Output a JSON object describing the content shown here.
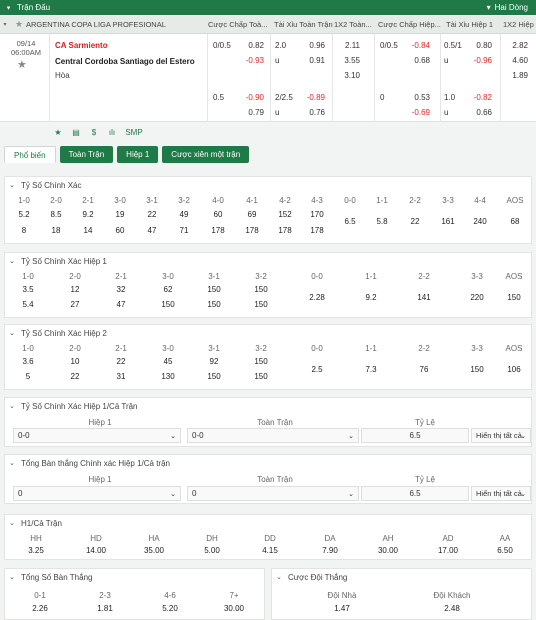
{
  "topbar": {
    "title": "Trận Đấu",
    "dropdown": "Hai Dòng"
  },
  "league": {
    "name": "ARGENTINA COPA LIGA PROFESIONAL",
    "headers": [
      "Cược Chấp Toà...",
      "Tài Xỉu Toàn Trận",
      "1X2 Toàn...",
      "Cược Chấp Hiệp...",
      "Tài Xỉu Hiệp 1",
      "1X2 Hiệp"
    ]
  },
  "match": {
    "date": "09/14",
    "time": "06:00AM",
    "home": "CA Sarmiento",
    "away": "Central Cordoba Santiago del Estero",
    "draw": "Hòa",
    "row1": {
      "ft_hdp_line": "0/0.5",
      "ft_hdp_home": "0.82",
      "ft_hdp_away": "-0.93",
      "ft_ou_line": "2.0",
      "ft_ou_over": "0.96",
      "ft_ou_u": "u",
      "ft_ou_under": "0.91",
      "ft_1x2_1": "2.11",
      "ft_1x2_2": "3.55",
      "ft_1x2_x": "3.10",
      "h1_hdp_line": "0/0.5",
      "h1_hdp_home": "-0.84",
      "h1_hdp_away": "0.68",
      "h1_ou_line": "0.5/1",
      "h1_ou_over": "0.80",
      "h1_ou_u": "u",
      "h1_ou_under": "-0.96",
      "h1_1x2_1": "2.82",
      "h1_1x2_2": "4.60",
      "h1_1x2_x": "1.89"
    },
    "row2": {
      "ft_hdp_line": "0.5",
      "ft_hdp_home": "-0.90",
      "ft_hdp_away": "0.79",
      "ft_ou_line": "2/2.5",
      "ft_ou_over": "-0.89",
      "ft_ou_u": "u",
      "ft_ou_under": "0.76",
      "h1_hdp_line": "0",
      "h1_hdp_home": "0.53",
      "h1_hdp_away": "-0.69",
      "h1_ou_line": "1.0",
      "h1_ou_over": "-0.82",
      "h1_ou_u": "u",
      "h1_ou_under": "0.66"
    },
    "tools": [
      "★",
      "▤",
      "$",
      "ılı",
      "SMP"
    ]
  },
  "tabs": [
    "Phổ biến",
    "Toàn Trận",
    "Hiệp 1",
    "Cược xiên một trận"
  ],
  "cs": {
    "title": "Tỷ Số Chính Xác",
    "h1": [
      "1-0",
      "2-0",
      "2-1",
      "3-0",
      "3-1",
      "3-2",
      "4-0",
      "4-1",
      "4-2",
      "4-3",
      "0-0",
      "1-1",
      "2-2",
      "3-3",
      "4-4",
      "AOS"
    ],
    "v1": [
      "5.2",
      "8.5",
      "9.2",
      "19",
      "22",
      "49",
      "60",
      "69",
      "152",
      "170",
      "6.5",
      "5.8",
      "22",
      "161",
      "240",
      "68"
    ],
    "v2": [
      "8",
      "18",
      "14",
      "60",
      "47",
      "71",
      "178",
      "178",
      "178",
      "178"
    ]
  },
  "cs1": {
    "title": "Tỷ Số Chính Xác Hiệp 1",
    "h": [
      "1-0",
      "2-0",
      "2-1",
      "3-0",
      "3-1",
      "3-2",
      "0-0",
      "1-1",
      "2-2",
      "3-3",
      "AOS"
    ],
    "v1": [
      "3.5",
      "12",
      "32",
      "62",
      "150",
      "150",
      "2.28",
      "9.2",
      "141",
      "220",
      "150"
    ],
    "v2": [
      "5.4",
      "27",
      "47",
      "150",
      "150",
      "150"
    ]
  },
  "cs2": {
    "title": "Tỷ Số Chính Xác Hiệp 2",
    "h": [
      "1-0",
      "2-0",
      "2-1",
      "3-0",
      "3-1",
      "3-2",
      "0-0",
      "1-1",
      "2-2",
      "3-3",
      "AOS"
    ],
    "v1": [
      "3.6",
      "10",
      "22",
      "45",
      "92",
      "150",
      "2.5",
      "7.3",
      "76",
      "150",
      "106"
    ],
    "v2": [
      "5",
      "22",
      "31",
      "130",
      "150",
      "150"
    ]
  },
  "htft_cs": {
    "title": "Tỷ Số Chính Xác Hiệp 1/Cả Trận",
    "col1": "Hiệp 1",
    "col2": "Toàn Trận",
    "col3": "Tỷ Lệ",
    "sel1": "0-0",
    "sel2": "0-0",
    "odds": "6.5",
    "show": "Hiển thị tất cả"
  },
  "tg_htft": {
    "title": "Tổng Bàn thắng Chính xác Hiệp 1/Cả trận",
    "col1": "Hiệp 1",
    "col2": "Toàn Trận",
    "col3": "Tỷ Lệ",
    "sel1": "0",
    "sel2": "0",
    "odds": "6.5",
    "show": "Hiển thị tất cả"
  },
  "htft": {
    "title": "H1/Cả Trận",
    "h": [
      "HH",
      "HD",
      "HA",
      "DH",
      "DD",
      "DA",
      "AH",
      "AD",
      "AA"
    ],
    "v": [
      "3.25",
      "14.00",
      "35.00",
      "5.00",
      "4.15",
      "7.90",
      "30.00",
      "17.00",
      "6.50"
    ]
  },
  "tg": {
    "title": "Tổng Số Bàn Thắng",
    "h": [
      "0-1",
      "2-3",
      "4-6",
      "7+"
    ],
    "v": [
      "2.26",
      "1.81",
      "5.20",
      "30.00"
    ]
  },
  "dc": {
    "title": "Cược Đội Thắng",
    "h": [
      "Đội Nhà",
      "Đội Khách"
    ],
    "v": [
      "1.47",
      "2.48"
    ]
  },
  "colors": {
    "green": "#1f7a47",
    "red": "#e02a2a"
  }
}
